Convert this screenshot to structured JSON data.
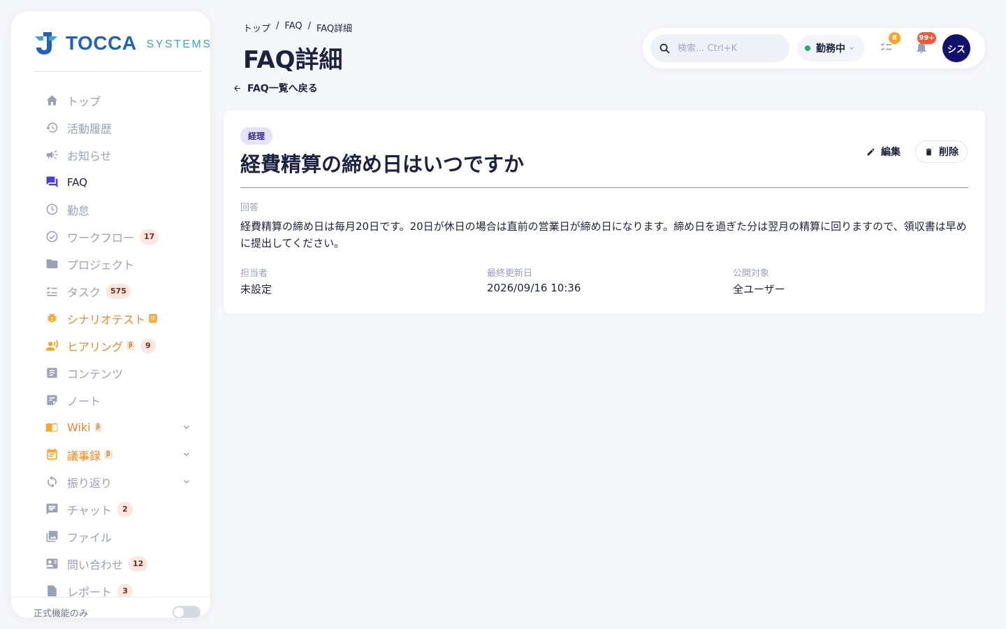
{
  "brand": {
    "name": "TOCCA",
    "sub": "SYSTEMS"
  },
  "sidebar": {
    "items": [
      {
        "label": "トップ"
      },
      {
        "label": "活動履歴"
      },
      {
        "label": "お知らせ"
      },
      {
        "label": "FAQ"
      },
      {
        "label": "勤怠"
      },
      {
        "label": "ワークフロー",
        "badge": "17"
      },
      {
        "label": "プロジェクト"
      },
      {
        "label": "タスク",
        "badge": "575"
      },
      {
        "label": "シナリオテスト",
        "tag": "α"
      },
      {
        "label": "ヒアリング",
        "tag": "β",
        "badge": "9"
      },
      {
        "label": "コンテンツ"
      },
      {
        "label": "ノート"
      },
      {
        "label": "Wiki",
        "tag": "β"
      },
      {
        "label": "議事録",
        "tag": "β"
      },
      {
        "label": "振り返り"
      },
      {
        "label": "チャット",
        "badge": "2"
      },
      {
        "label": "ファイル"
      },
      {
        "label": "問い合わせ",
        "badge": "12"
      },
      {
        "label": "レポート",
        "badge": "3"
      }
    ],
    "footer_label": "正式機能のみ"
  },
  "breadcrumb": {
    "home": "トップ",
    "sep1": "/",
    "faq": "FAQ",
    "sep2": "/",
    "current": "FAQ詳細"
  },
  "page_title": "FAQ詳細",
  "back_link": "FAQ一覧へ戻る",
  "topbar": {
    "search_placeholder": "検索... Ctrl+K",
    "status_label": "勤務中",
    "task_count": "8",
    "notification_count": "99+",
    "avatar_text": "シス"
  },
  "faq": {
    "category": "経理",
    "question": "経費精算の締め日はいつですか",
    "edit_label": "編集",
    "delete_label": "削除",
    "answer_label": "回答",
    "answer": "経費精算の締め日は毎月20日です。20日が休日の場合は直前の営業日が締め日になります。締め日を過ぎた分は翌月の精算に回りますので、領収書は早めに提出してください。",
    "assignee_label": "担当者",
    "assignee": "未設定",
    "updated_label": "最終更新日",
    "updated": "2026/09/16 10:36",
    "audience_label": "公開対象",
    "audience": "全ユーザー"
  },
  "colors": {
    "primary": "#1c2140",
    "muted": "#9aa0b8",
    "accent_orange": "#e58a2f",
    "active_icon": "#4a3fd6",
    "status_green": "#1fb26b",
    "badge_orange": "#f5a623",
    "badge_red": "#ee5a3a"
  }
}
